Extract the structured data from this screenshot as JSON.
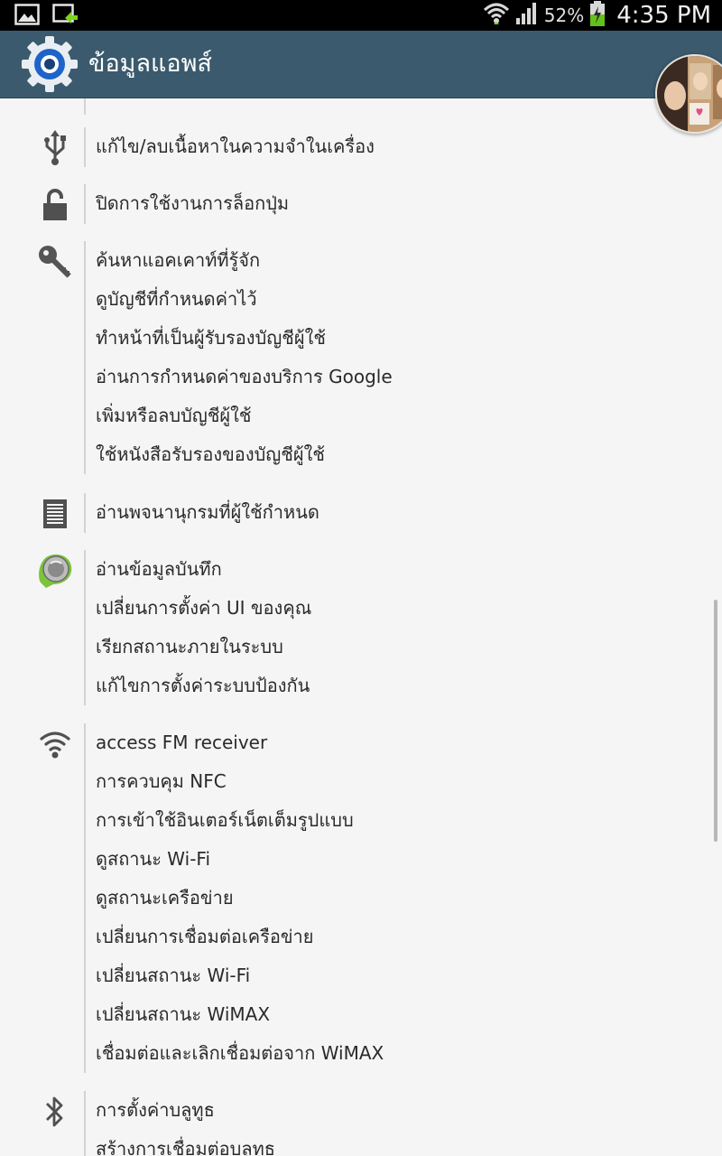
{
  "status_bar": {
    "battery_percent": "52%",
    "time": "4:35 PM",
    "icons": [
      "gallery-icon",
      "sync-icon",
      "wifi-icon",
      "signal-icon",
      "battery-charging-icon"
    ]
  },
  "action_bar": {
    "title": "ข้อมูลแอพส์",
    "icon": "settings-gear-icon"
  },
  "groups": [
    {
      "icon": "usb-icon",
      "items": [
        "แก้ไข/ลบเนื้อหาในความจำในเครื่อง"
      ]
    },
    {
      "icon": "lock-icon",
      "items": [
        "ปิดการใช้งานการล็อกปุ่ม"
      ]
    },
    {
      "icon": "key-icon",
      "items": [
        "ค้นหาแอคเคาท์ที่รู้จัก",
        "ดูบัญชีที่กำหนดค่าไว้",
        "ทำหน้าที่เป็นผู้รับรองบัญชีผู้ใช้",
        "อ่านการกำหนดค่าของบริการ Google",
        "เพิ่มหรือลบบัญชีผู้ใช้",
        "ใช้หนังสือรับรองของบัญชีผู้ใช้"
      ]
    },
    {
      "icon": "dictionary-icon",
      "items": [
        "อ่านพจนานุกรมที่ผู้ใช้กำหนด"
      ]
    },
    {
      "icon": "system-tools-icon",
      "items": [
        "อ่านข้อมูลบันทึก",
        "เปลี่ยนการตั้งค่า UI ของคุณ",
        "เรียกสถานะภายในระบบ",
        "แก้ไขการตั้งค่าระบบป้องกัน"
      ]
    },
    {
      "icon": "wifi-icon",
      "items": [
        "access FM receiver",
        "การควบคุม NFC",
        "การเข้าใช้อินเตอร์เน็ตเต็มรูปแบบ",
        "ดูสถานะ Wi-Fi",
        "ดูสถานะเครือข่าย",
        "เปลี่ยนการเชื่อมต่อเครือข่าย",
        "เปลี่ยนสถานะ Wi-Fi",
        "เปลี่ยนสถานะ WiMAX",
        "เชื่อมต่อและเลิกเชื่อมต่อจาก WiMAX"
      ]
    },
    {
      "icon": "bluetooth-icon",
      "items": [
        "การตั้งค่าบลูทูธ",
        "สร้างการเชื่อมต่อบลูทูธ"
      ]
    }
  ]
}
